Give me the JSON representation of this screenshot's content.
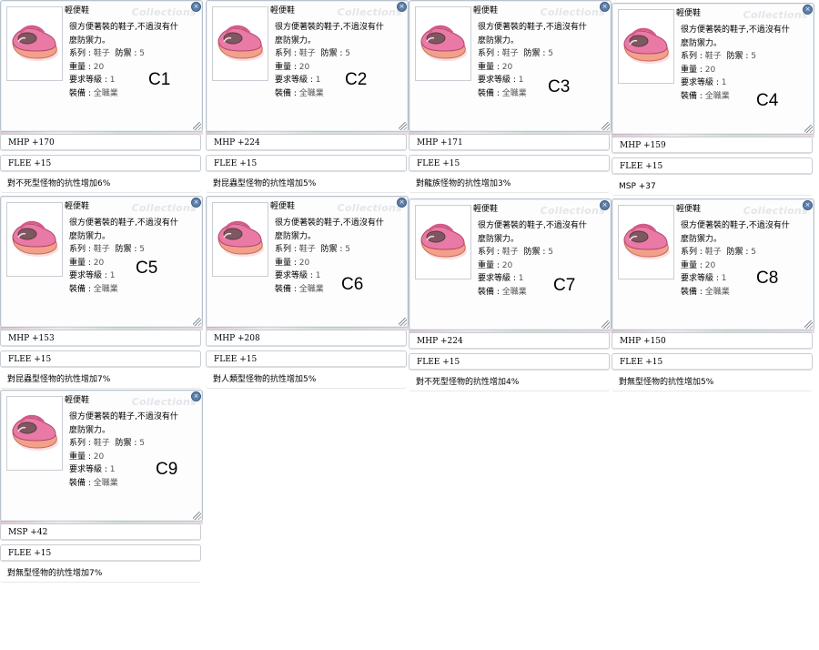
{
  "item": {
    "name": "輕便鞋",
    "desc_line1": "很方便著裝的鞋子,不過沒有什",
    "desc_line2": "麼防禦力。",
    "type_label": "系列 : ",
    "type_value": "鞋子",
    "def_label": "防禦 : ",
    "def_value": "5",
    "weight_label": "重量 : ",
    "weight_value": "20",
    "level_label": "要求等級 : ",
    "level_value": "1",
    "equip_label": "裝備 : ",
    "equip_value": "全職業",
    "watermark": "Collections",
    "close_glyph": "×"
  },
  "cards": [
    {
      "label": "C1",
      "stat1": "MHP +170",
      "stat2": "FLEE +15",
      "stat3": "對不死型怪物的抗性增加6%"
    },
    {
      "label": "C2",
      "stat1": "MHP +224",
      "stat2": "FLEE +15",
      "stat3": "對昆蟲型怪物的抗性增加5%"
    },
    {
      "label": "C3",
      "stat1": "MHP +171",
      "stat2": "FLEE +15",
      "stat3": "對龍族怪物的抗性增加3%"
    },
    {
      "label": "C4",
      "stat1": "MHP +159",
      "stat2": "FLEE +15",
      "stat3": "MSP +37"
    },
    {
      "label": "C5",
      "stat1": "MHP +153",
      "stat2": "FLEE +15",
      "stat3": "對昆蟲型怪物的抗性增加7%"
    },
    {
      "label": "C6",
      "stat1": "MHP +208",
      "stat2": "FLEE +15",
      "stat3": "對人類型怪物的抗性增加5%"
    },
    {
      "label": "C7",
      "stat1": "MHP +224",
      "stat2": "FLEE +15",
      "stat3": "對不死型怪物的抗性增加4%"
    },
    {
      "label": "C8",
      "stat1": "MHP +150",
      "stat2": "FLEE +15",
      "stat3": "對無型怪物的抗性增加5%"
    },
    {
      "label": "C9",
      "stat1": "MSP +42",
      "stat2": "FLEE +15",
      "stat3": "對無型怪物的抗性增加7%"
    }
  ],
  "colors": {
    "shoe_body": "#e97aa6",
    "shoe_sole": "#f3a08a",
    "window_border": "#b9c3cd",
    "close_button": "#5d7fa8"
  }
}
